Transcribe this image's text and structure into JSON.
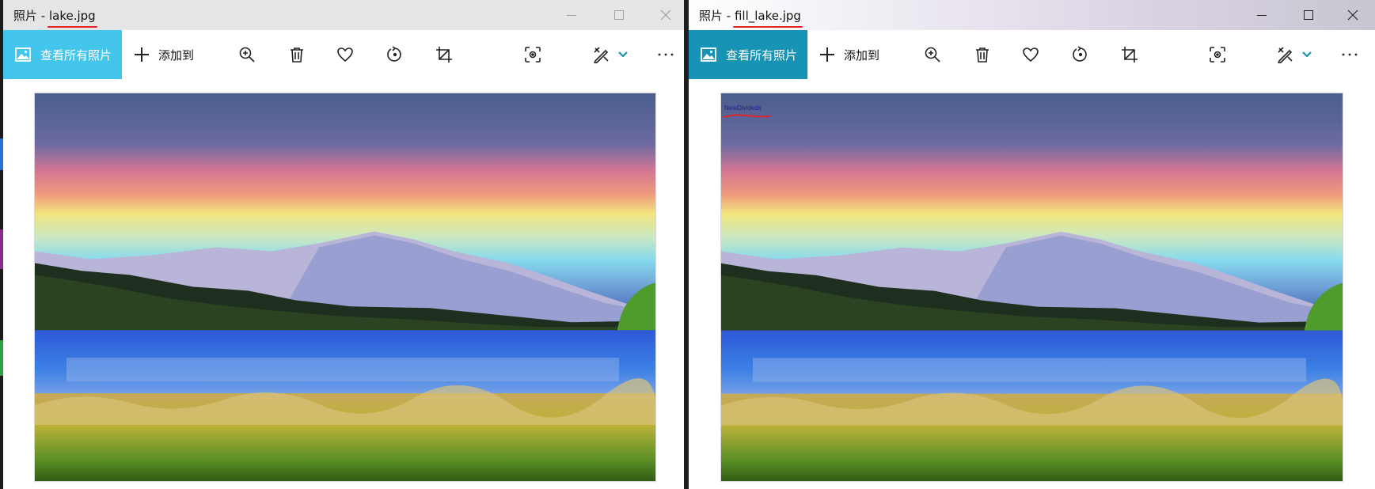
{
  "left_window": {
    "title_prefix": "照片 - ",
    "filename": "lake.jpg",
    "toolbar": {
      "see_all_photos": "查看所有照片",
      "add_to": "添加到"
    }
  },
  "right_window": {
    "title_prefix": "照片 - ",
    "filename": "fill_lake.jpg",
    "toolbar": {
      "see_all_photos": "查看所有照片",
      "add_to": "添加到"
    },
    "watermark_text": "NewDivideds"
  },
  "colors": {
    "accent_inactive": "#44c6ec",
    "accent_active": "#1693b5",
    "annotation_red": "#e0242b"
  },
  "icons": [
    "picture-icon",
    "plus-icon",
    "zoom-in-icon",
    "delete-icon",
    "heart-icon",
    "rotate-icon",
    "crop-icon",
    "focus-icon",
    "edit-icon",
    "chevron-down-icon",
    "more-icon",
    "minimize-icon",
    "maximize-icon",
    "close-icon"
  ]
}
